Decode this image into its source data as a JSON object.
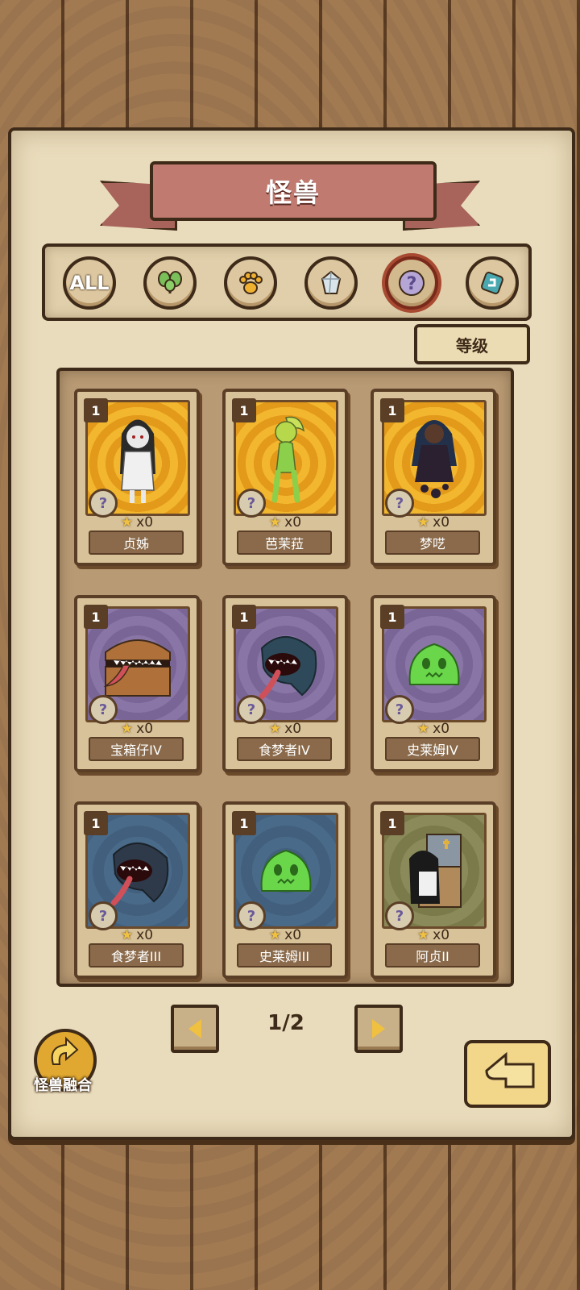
{
  "header": {
    "title": "怪兽"
  },
  "filters": [
    {
      "label": "ALL",
      "icon": "all-icon",
      "active": false
    },
    {
      "label": "",
      "icon": "leaf-icon",
      "active": false
    },
    {
      "label": "",
      "icon": "paw-icon",
      "active": false
    },
    {
      "label": "",
      "icon": "crystal-icon",
      "active": false
    },
    {
      "label": "",
      "icon": "question-icon",
      "active": true
    },
    {
      "label": "",
      "icon": "spiral-icon",
      "active": false
    }
  ],
  "sort": {
    "label": "等级"
  },
  "cards": [
    {
      "level": "1",
      "count": "x0",
      "name": "贞姊",
      "bg": "gold",
      "monster": "ghost-girl"
    },
    {
      "level": "1",
      "count": "x0",
      "name": "芭茉菈",
      "bg": "gold",
      "monster": "plant-girl"
    },
    {
      "level": "1",
      "count": "x0",
      "name": "梦呓",
      "bg": "gold",
      "monster": "dark-girl"
    },
    {
      "level": "1",
      "count": "x0",
      "name": "宝箱仔IV",
      "bg": "purple",
      "monster": "mimic-chest"
    },
    {
      "level": "1",
      "count": "x0",
      "name": "食梦者IV",
      "bg": "purple",
      "monster": "dream-eater"
    },
    {
      "level": "1",
      "count": "x0",
      "name": "史莱姆IV",
      "bg": "purple",
      "monster": "slime"
    },
    {
      "level": "1",
      "count": "x0",
      "name": "食梦者III",
      "bg": "blue",
      "monster": "dream-eater"
    },
    {
      "level": "1",
      "count": "x0",
      "name": "史莱姆III",
      "bg": "blue",
      "monster": "slime"
    },
    {
      "level": "1",
      "count": "x0",
      "name": "阿贞II",
      "bg": "olive",
      "monster": "box-ghost"
    }
  ],
  "pagination": {
    "text": "1/2"
  },
  "fusion": {
    "label": "怪兽融合"
  },
  "colors": {
    "ribbon": "#c07a70",
    "star": "#f0c040",
    "frame": "#3e2a18"
  }
}
